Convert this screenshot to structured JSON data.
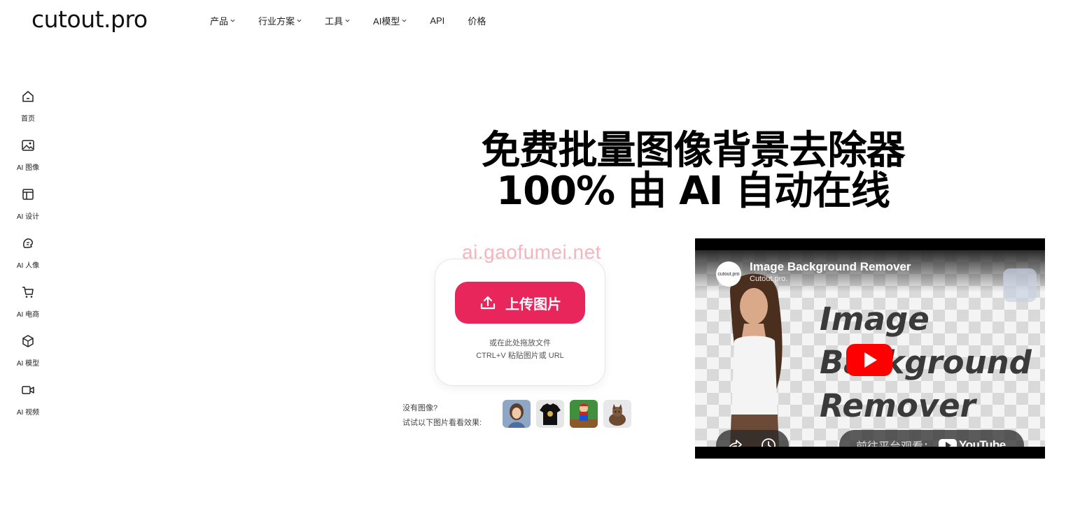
{
  "header": {
    "logo": "cutout.pro",
    "nav": [
      {
        "label": "产品",
        "dropdown": true
      },
      {
        "label": "行业方案",
        "dropdown": true
      },
      {
        "label": "工具",
        "dropdown": true
      },
      {
        "label": "AI模型",
        "dropdown": true
      },
      {
        "label": "API",
        "dropdown": false
      },
      {
        "label": "价格",
        "dropdown": false
      }
    ]
  },
  "sidebar": {
    "items": [
      {
        "label": "首页",
        "icon": "home-icon"
      },
      {
        "label": "AI 图像",
        "icon": "image-icon"
      },
      {
        "label": "AI 设计",
        "icon": "design-icon"
      },
      {
        "label": "AI 人像",
        "icon": "portrait-icon"
      },
      {
        "label": "AI 电商",
        "icon": "cart-icon"
      },
      {
        "label": "AI 模型",
        "icon": "cube-icon"
      },
      {
        "label": "AI 视频",
        "icon": "video-icon"
      }
    ]
  },
  "hero": {
    "title_line1": "免费批量图像背景去除器",
    "title_line2": "100% 由 AI 自动在线"
  },
  "upload": {
    "watermark": "ai.gaofumei.net",
    "button_label": "上传图片",
    "hint_line1": "或在此处拖放文件",
    "hint_line2": "CTRL+V 粘贴图片或 URL"
  },
  "samples": {
    "line1": "没有图像?",
    "line2": "试试以下图片看看效果:",
    "thumbs": [
      "sample-girl",
      "sample-tshirt",
      "sample-mario",
      "sample-dog"
    ]
  },
  "video": {
    "channel_avatar_text": "cutout.pro",
    "title": "Image Background Remover",
    "channel": "Cutout.pro.",
    "overlay_line1": "Image",
    "overlay_line2": "Background",
    "overlay_line3": "Remover",
    "watch_on": "前往平台观看：",
    "youtube": "YouTube"
  },
  "colors": {
    "accent": "#e9265b",
    "youtube_red": "#ff0000"
  }
}
